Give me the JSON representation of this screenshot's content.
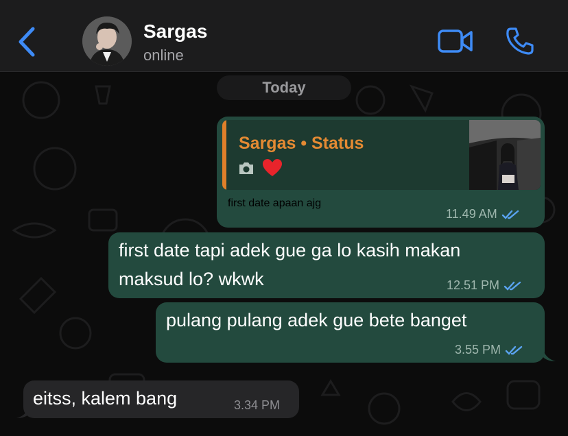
{
  "header": {
    "back_icon": "chevron-left-icon",
    "contact_name": "Sargas",
    "contact_status": "online",
    "video_icon": "video-camera-icon",
    "call_icon": "phone-icon",
    "accent_color": "#3e8bf6"
  },
  "chat": {
    "date_label": "Today",
    "messages": [
      {
        "direction": "outgoing",
        "reply": {
          "title": "Sargas • Status",
          "icons": [
            "camera-icon",
            "heart-icon"
          ]
        },
        "text": "first date apaan ajg",
        "time": "11.49 AM",
        "status_icon": "double-check-icon"
      },
      {
        "direction": "outgoing",
        "lines": [
          "first date tapi adek gue ga lo kasih makan",
          "maksud lo? wkwk"
        ],
        "time": "12.51 PM",
        "status_icon": "double-check-icon"
      },
      {
        "direction": "outgoing",
        "text": "pulang pulang adek gue bete banget",
        "time": "3.55 PM",
        "status_icon": "double-check-icon"
      },
      {
        "direction": "incoming",
        "text": "eitss, kalem bang",
        "time": "3.34 PM"
      }
    ]
  },
  "colors": {
    "outgoing_bubble": "#234a3e",
    "incoming_bubble": "#262628",
    "reply_accent": "#e0802a",
    "read_ticks": "#5aa3f0"
  }
}
